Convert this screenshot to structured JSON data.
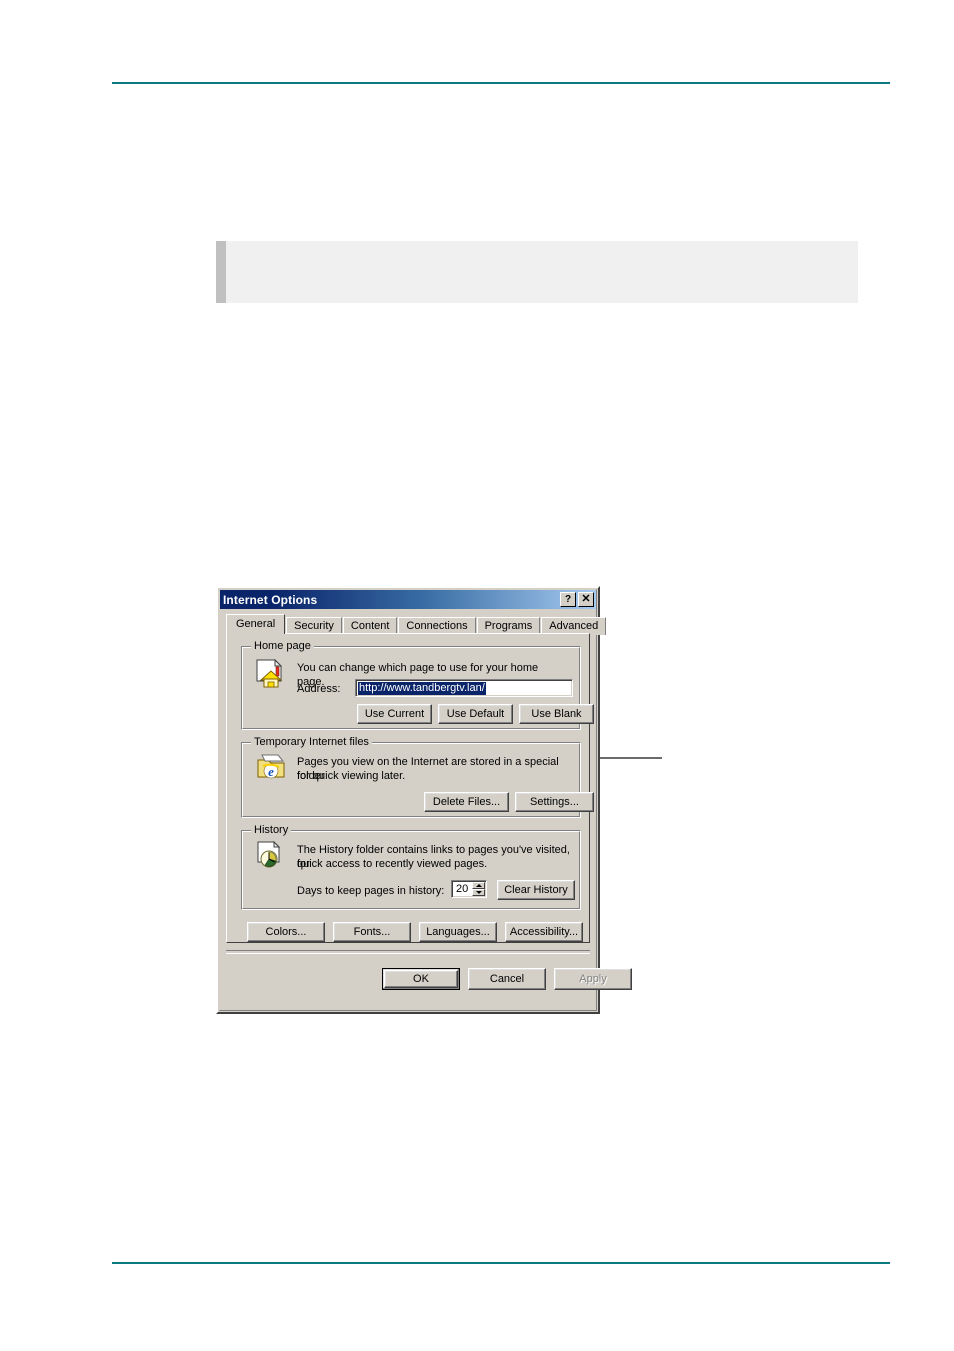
{
  "page": {
    "header_rule_color": "#0a7a80",
    "footer_rule_color": "#0a7a80",
    "note_box_text": ""
  },
  "dialog": {
    "title": "Internet Options",
    "titlebar_gradient_from": "#0a246a",
    "titlebar_gradient_to": "#a6caf0",
    "help_button": "?",
    "close_button": "✕",
    "tabs": [
      {
        "label": "General",
        "active": true
      },
      {
        "label": "Security",
        "active": false
      },
      {
        "label": "Content",
        "active": false
      },
      {
        "label": "Connections",
        "active": false
      },
      {
        "label": "Programs",
        "active": false
      },
      {
        "label": "Advanced",
        "active": false
      }
    ],
    "home_page": {
      "group_title": "Home page",
      "description": "You can change which page to use for your home page.",
      "address_label": "Address:",
      "address_value": "http://www.tandbergtv.lan/",
      "address_selected": true,
      "selection_color": "#0a246a",
      "buttons": [
        {
          "label": "Use Current"
        },
        {
          "label": "Use Default"
        },
        {
          "label": "Use Blank"
        }
      ]
    },
    "temp_files": {
      "group_title": "Temporary Internet files",
      "description_line1": "Pages you view on the Internet are stored in a special folder",
      "description_line2": "for quick viewing later.",
      "buttons": [
        {
          "label": "Delete Files..."
        },
        {
          "label": "Settings..."
        }
      ]
    },
    "history": {
      "group_title": "History",
      "description_line1": "The History folder contains links to pages you've visited, for",
      "description_line2": "quick access to recently viewed pages.",
      "days_label": "Days to keep pages in history:",
      "days_value": "20",
      "clear_button": "Clear History"
    },
    "extra_buttons": [
      {
        "label": "Colors..."
      },
      {
        "label": "Fonts..."
      },
      {
        "label": "Languages..."
      },
      {
        "label": "Accessibility..."
      }
    ],
    "footer_buttons": [
      {
        "label": "OK",
        "state": "default"
      },
      {
        "label": "Cancel",
        "state": "normal"
      },
      {
        "label": "Apply",
        "state": "disabled"
      }
    ]
  }
}
